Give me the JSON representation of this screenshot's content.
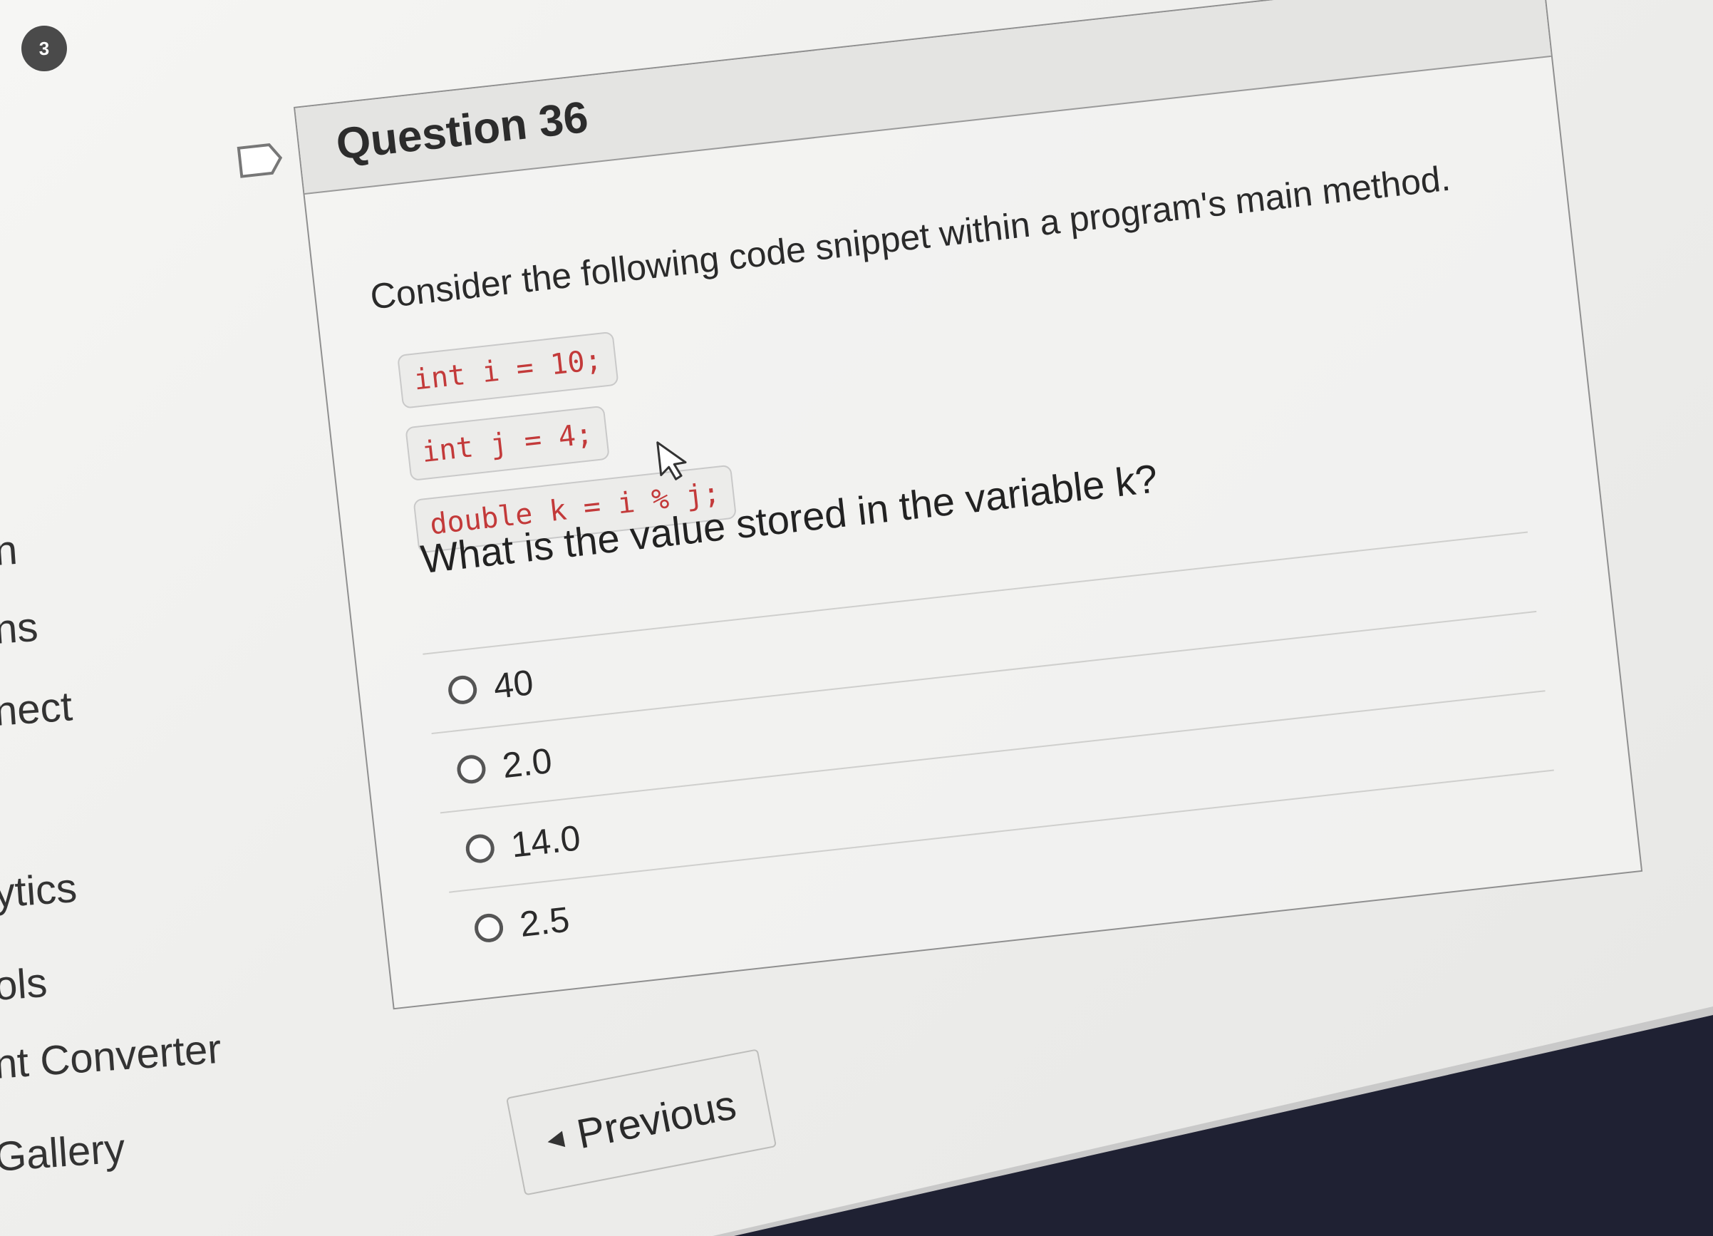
{
  "sidebar": {
    "badge_count": "3",
    "items": [
      {
        "label": "n"
      },
      {
        "label": "ns"
      },
      {
        "label": "nect"
      },
      {
        "label": "ytics"
      },
      {
        "label": "ols"
      },
      {
        "label": "nt Converter"
      },
      {
        "label": "Gallery"
      }
    ]
  },
  "question": {
    "title": "Question 36",
    "prompt": "Consider the following code snippet within a program's main method.",
    "code_lines": [
      "int i = 10;",
      "int j = 4;",
      "double k = i % j;"
    ],
    "question_text": "What is the value stored in the variable k?",
    "options": [
      {
        "label": "40"
      },
      {
        "label": "2.0"
      },
      {
        "label": "14.0"
      },
      {
        "label": "2.5"
      }
    ]
  },
  "navigation": {
    "previous_label": "Previous",
    "previous_icon": "caret-left-icon"
  },
  "icons": {
    "flag": "flag-icon",
    "cursor": "mouse-cursor-icon"
  },
  "colors": {
    "code_text": "#c33a3a",
    "badge_bg": "#4a4a4a"
  }
}
